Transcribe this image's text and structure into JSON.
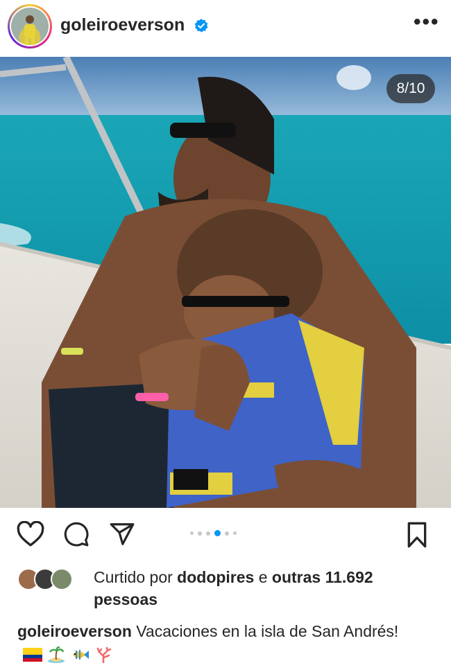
{
  "post": {
    "username": "goleiroeverson",
    "verified": true,
    "carousel_counter": "8/10",
    "carousel_index": 8,
    "carousel_total": 10,
    "likes": {
      "prefix": "Curtido por",
      "user": "dodopires",
      "connector": "e",
      "others": "outras 11.692",
      "suffix": "pessoas"
    },
    "caption": {
      "username": "goleiroeverson",
      "text": "Vacaciones en la isla de San Andrés!"
    },
    "caption_emojis": [
      "colombia-flag",
      "desert-island",
      "tropical-fish",
      "coral"
    ],
    "actions": [
      "heart-icon",
      "comment-icon",
      "share-icon",
      "bookmark-icon"
    ]
  },
  "colors": {
    "accent": "#0095f6",
    "text": "#262626",
    "verified": "#0095f6"
  }
}
